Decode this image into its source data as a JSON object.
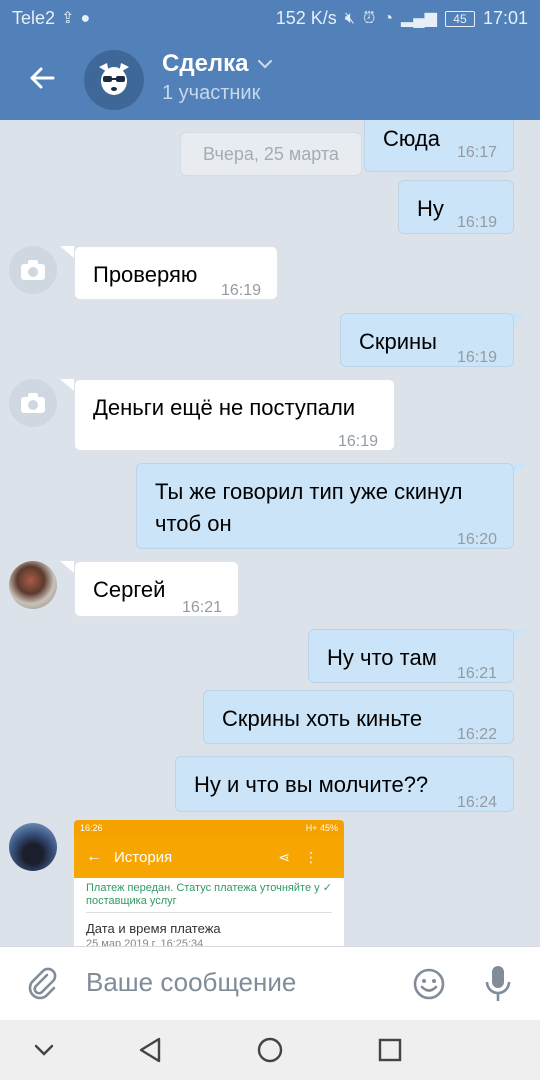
{
  "status_bar": {
    "carrier": "Tele2",
    "speed": "152 K/s",
    "battery": "45",
    "time": "17:01"
  },
  "header": {
    "title": "Сделка",
    "subtitle": "1 участник"
  },
  "date_separator": "Вчера, 25 марта",
  "messages": [
    {
      "text": "Сюда",
      "time": "16:17",
      "dir": "out"
    },
    {
      "text": "Ну",
      "time": "16:19",
      "dir": "out"
    },
    {
      "text": "Проверяю",
      "time": "16:19",
      "dir": "in"
    },
    {
      "text": "Скрины",
      "time": "16:19",
      "dir": "out"
    },
    {
      "text": "Деньги ещё не поступали",
      "time": "16:19",
      "dir": "in"
    },
    {
      "text_line1": "Ты же говорил тип уже скинул",
      "text_line2": "чтоб он",
      "time": "16:20",
      "dir": "out"
    },
    {
      "text": "Сергей",
      "time": "16:21",
      "dir": "in"
    },
    {
      "text": "Ну что там",
      "time": "16:21",
      "dir": "out"
    },
    {
      "text": "Скрины хоть киньте",
      "time": "16:22",
      "dir": "out"
    },
    {
      "text": "Ну и что вы молчите??",
      "time": "16:24",
      "dir": "out"
    }
  ],
  "screenshot_message": {
    "status_time": "16:26",
    "status_right": "H+ 45%",
    "bar_title": "История",
    "status_line1": "Платеж передан. Статус платежа уточняйте у",
    "status_line2": "поставщика услуг",
    "label": "Дата и время платежа",
    "date": "25 мар 2019 г. 16:25:34"
  },
  "input": {
    "placeholder": "Ваше сообщение"
  },
  "colors": {
    "header_bg": "#5181b8",
    "outgoing_bubble": "#cce4f7",
    "incoming_bubble": "#ffffff",
    "chat_bg": "#dbe2ea"
  }
}
